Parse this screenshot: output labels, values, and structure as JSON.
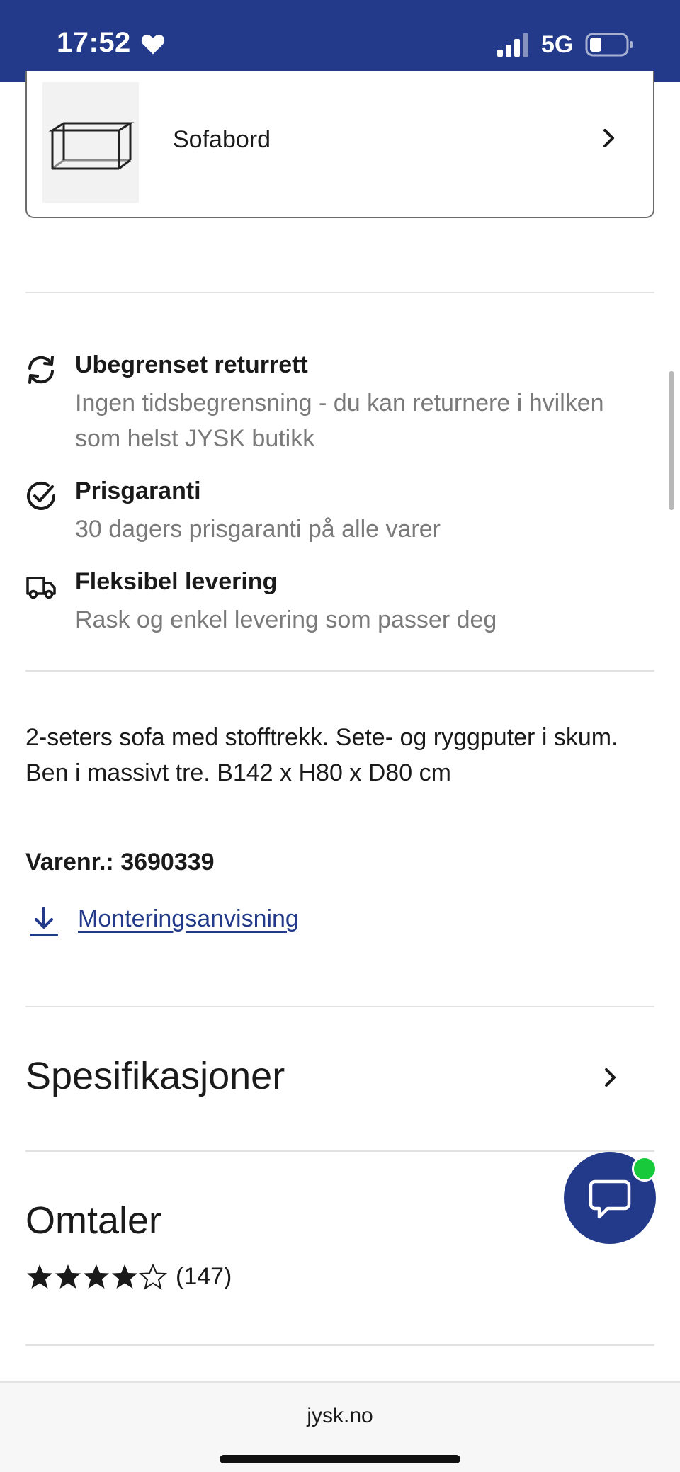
{
  "status_bar": {
    "time": "17:52",
    "network": "5G",
    "icons": [
      "heart-icon",
      "signal-icon",
      "battery-icon"
    ]
  },
  "related_product": {
    "name": "Sofabord"
  },
  "usps": [
    {
      "icon": "refresh-icon",
      "title": "Ubegrenset returrett",
      "description": "Ingen tidsbegrensning - du kan returnere i hvilken som helst JYSK butikk"
    },
    {
      "icon": "check-circle-icon",
      "title": "Prisgaranti",
      "description": "30 dagers prisgaranti på alle varer"
    },
    {
      "icon": "truck-icon",
      "title": "Fleksibel levering",
      "description": "Rask og enkel levering som passer deg"
    }
  ],
  "product": {
    "description": "2-seters sofa med stofftrekk. Sete- og ryggputer i skum. Ben i massivt tre. B142 x H80 x D80 cm",
    "article_number": "Varenr.: 3690339",
    "assembly_link": "Monteringsanvisning"
  },
  "sections": {
    "specifications": "Spesifikasjoner",
    "reviews": "Omtaler",
    "rating": 4,
    "rating_max": 5,
    "review_count": "(147)"
  },
  "browser": {
    "url": "jysk.no"
  },
  "colors": {
    "brand": "#233a8a",
    "online": "#18c93b",
    "muted_text": "#7a7a7a"
  }
}
